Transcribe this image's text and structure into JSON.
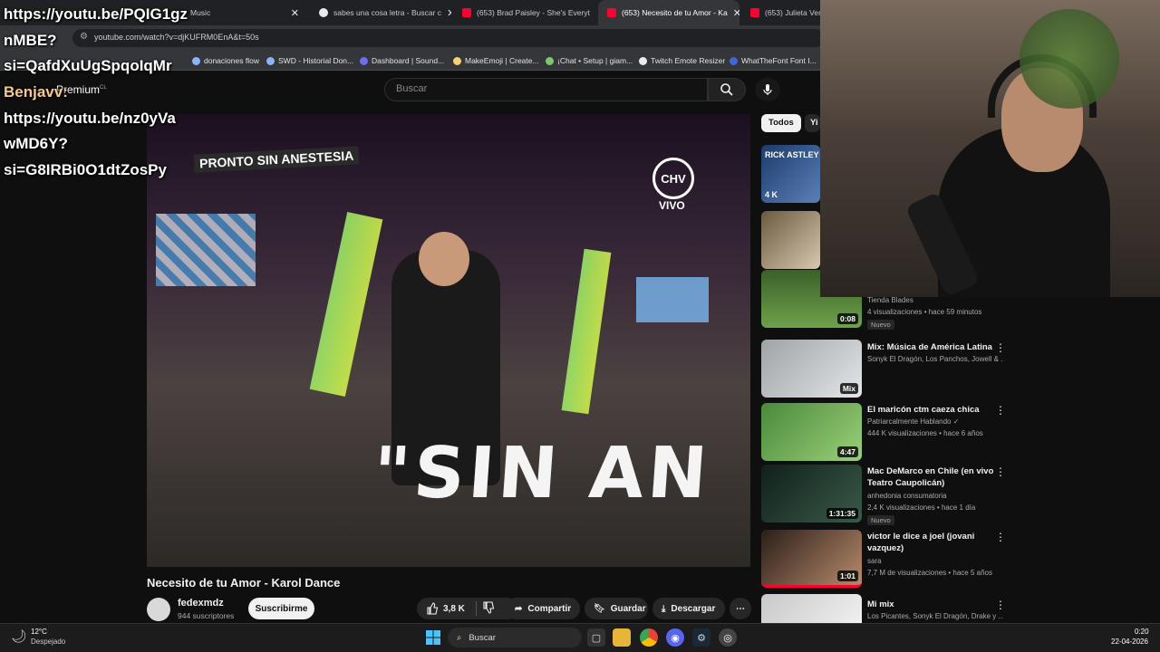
{
  "browser": {
    "tabs": [
      {
        "label": "Music",
        "icon": "youtube-icon"
      },
      {
        "label": "sabes una cosa letra - Buscar c",
        "icon": "google-icon"
      },
      {
        "label": "(653) Brad Paisley - She's Everyt",
        "icon": "youtube-icon"
      },
      {
        "label": "(653) Necesito de tu Amor - Ka",
        "icon": "youtube-icon",
        "active": true
      },
      {
        "label": "(653) Julieta Veneg",
        "icon": "youtube-icon"
      }
    ],
    "url": "youtube.com/watch?v=djKUFRM0EnA&t=50s",
    "bookmarks": [
      "donaciones flow",
      "SWD - Historial Don...",
      "Dashboard | Sound...",
      "MakeEmoji | Create...",
      "¡Chat • Setup | giam...",
      "Twitch Emote Resizer",
      "WhatTheFont Font I..."
    ]
  },
  "overlay": {
    "line1": "https://youtu.be/PQIG1gz",
    "line2": "nMBE?",
    "line3": "si=QafdXuUgSpqoIqMr",
    "name": "Benjavv:",
    "line4": "https://youtu.be/nz0yVa",
    "line5": "wMD6Y?",
    "line6": "si=G8IRBi0O1dtZosPy"
  },
  "youtube": {
    "premium_label": "Premium",
    "premium_region": "CL",
    "search_placeholder": "Buscar",
    "video": {
      "title": "Necesito de tu Amor - Karol Dance",
      "overlay_sin": "\"SIN AN",
      "overlay_pronto": "PRONTO SIN ANESTESIA",
      "overlay_chv": "CHV",
      "overlay_vivo": "VIVO"
    },
    "channel": {
      "name": "fedexmdz",
      "subscribers": "944 suscriptores",
      "subscribe_label": "Suscribirme"
    },
    "actions": {
      "likes": "3,8 K",
      "share": "Compartir",
      "save": "Guardar",
      "download": "Descargar"
    },
    "chips": [
      "Todos",
      "Yi"
    ],
    "recommendations": [
      {
        "thumb_text": "RICK ASTLEY",
        "duration": "4 K"
      },
      {
        "thumb_text": "",
        "duration": ""
      },
      {
        "title": "",
        "channel": "Tienda Blades",
        "meta": "4 visualizaciones • hace 59 minutos",
        "badge": "Nuevo",
        "duration": "0:08"
      },
      {
        "title": "Mix: Música de América Latina",
        "channel": "Sonyk El Dragón, Los Panchos, Jowell & ...",
        "meta": "",
        "badge": "",
        "duration": "Mix"
      },
      {
        "title": "El maricón ctm caeza chica",
        "channel": "Patriarcalmente Hablando ✓",
        "meta": "444 K visualizaciones • hace 6 años",
        "badge": "",
        "duration": "4:47"
      },
      {
        "title": "Mac DeMarco en Chile (en vivo Teatro Caupolicán)",
        "channel": "anhedonia consumatoria",
        "meta": "2,4 K visualizaciones • hace 1 día",
        "badge": "Nuevo",
        "duration": "1:31:35"
      },
      {
        "title": "victor le dice a joel (jovani vazquez)",
        "channel": "sara",
        "meta": "7,7 M de visualizaciones • hace 5 años",
        "badge": "",
        "duration": "1:01"
      },
      {
        "title": "Mi mix",
        "channel": "Los Picantes, Sonyk El Dragón, Drake y ...",
        "meta": "",
        "badge": "",
        "duration": ""
      }
    ]
  },
  "taskbar": {
    "weather_temp": "12°C",
    "weather_desc": "Despejado",
    "search_label": "Buscar",
    "time": "0:20",
    "date": "22-04-2026"
  },
  "colors": {
    "accent": "#ff0033",
    "background": "#0f0f0f"
  }
}
